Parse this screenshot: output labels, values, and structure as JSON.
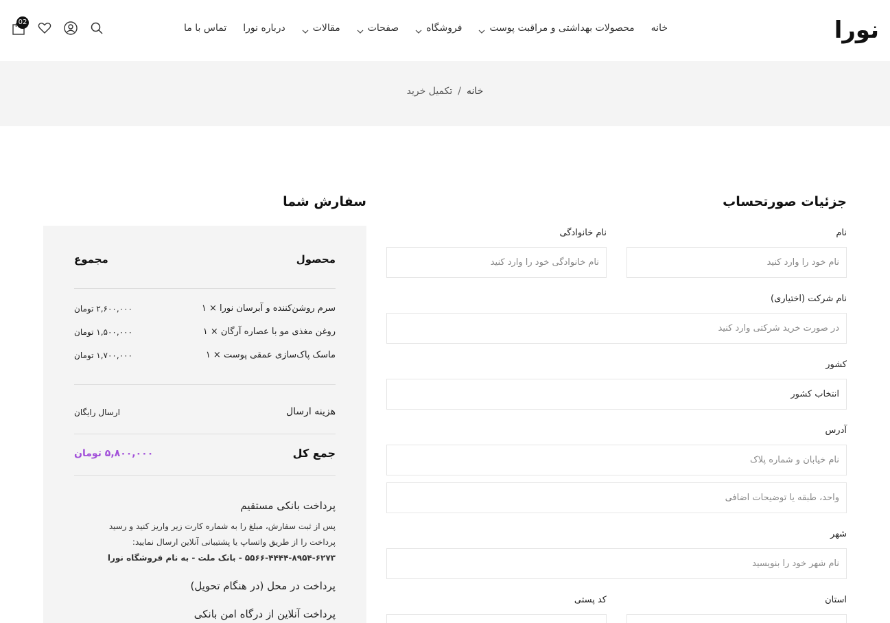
{
  "header": {
    "logo": "نورا",
    "nav": [
      {
        "label": "خانه",
        "dropdown": false
      },
      {
        "label": "محصولات بهداشتی و مراقبت پوست",
        "dropdown": true
      },
      {
        "label": "فروشگاه",
        "dropdown": true
      },
      {
        "label": "صفحات",
        "dropdown": true
      },
      {
        "label": "مقالات",
        "dropdown": true
      },
      {
        "label": "درباره نورا",
        "dropdown": false
      },
      {
        "label": "تماس با ما",
        "dropdown": false
      }
    ],
    "cart_count": "02"
  },
  "breadcrumb": {
    "home": "خانه",
    "separator": "/",
    "current": "تکمیل خرید"
  },
  "billing": {
    "title": "جزئیات صورتحساب",
    "first_name": {
      "label": "نام",
      "placeholder": "نام خود را وارد کنید"
    },
    "last_name": {
      "label": "نام خانوادگی",
      "placeholder": "نام خانوادگی خود را وارد کنید"
    },
    "company": {
      "label": "نام شرکت (اختیاری)",
      "placeholder": "در صورت خرید شرکتی وارد کنید"
    },
    "country": {
      "label": "کشور",
      "value": "انتخاب کشور"
    },
    "address": {
      "label": "آدرس",
      "placeholder1": "نام خیابان و شماره پلاک",
      "placeholder2": "واحد، طبقه یا توضیحات اضافی"
    },
    "city": {
      "label": "شهر",
      "placeholder": "نام شهر خود را بنویسید"
    },
    "state": {
      "label": "استان"
    },
    "postcode": {
      "label": "کد پستی"
    }
  },
  "order": {
    "title": "سفارش شما",
    "col_product": "محصول",
    "col_total": "مجموع",
    "items": [
      {
        "name": "سرم روشن‌کننده و آبرسان نورا × ۱",
        "price": "۲,۶۰۰,۰۰۰ تومان"
      },
      {
        "name": "روغن مغذی مو با عصاره آرگان × ۱",
        "price": "۱,۵۰۰,۰۰۰ تومان"
      },
      {
        "name": "ماسک پاک‌سازی عمقی پوست × ۱",
        "price": "۱,۷۰۰,۰۰۰ تومان"
      }
    ],
    "shipping_label": "هزینه ارسال",
    "shipping_value": "ارسال رایگان",
    "total_label": "جمع کل",
    "total_value": "۵,۸۰۰,۰۰۰ تومان",
    "payments": {
      "bank_title": "پرداخت بانکی مستقیم",
      "bank_desc": "پس از ثبت سفارش، مبلغ را به شماره کارت زیر واریز کنید و رسید پرداخت را از طریق واتساپ یا پشتیبانی آنلاین ارسال نمایید:",
      "bank_card": "۵۵۶۶-۴۴۴۴-۸۹۵۴-۶۲۷۳ - بانک ملت - به نام فروشگاه نورا",
      "cod_title": "پرداخت در محل (در هنگام تحویل)",
      "online_title": "پرداخت آنلاین از درگاه امن بانکی"
    }
  },
  "colors": {
    "accent_total": "#a14fd9",
    "breadcrumb_bg": "#f4f4f4",
    "order_bg": "#f4f4f4"
  },
  "icons": [
    "cart-icon",
    "heart-icon",
    "user-icon",
    "search-icon",
    "chevron-down-icon"
  ]
}
